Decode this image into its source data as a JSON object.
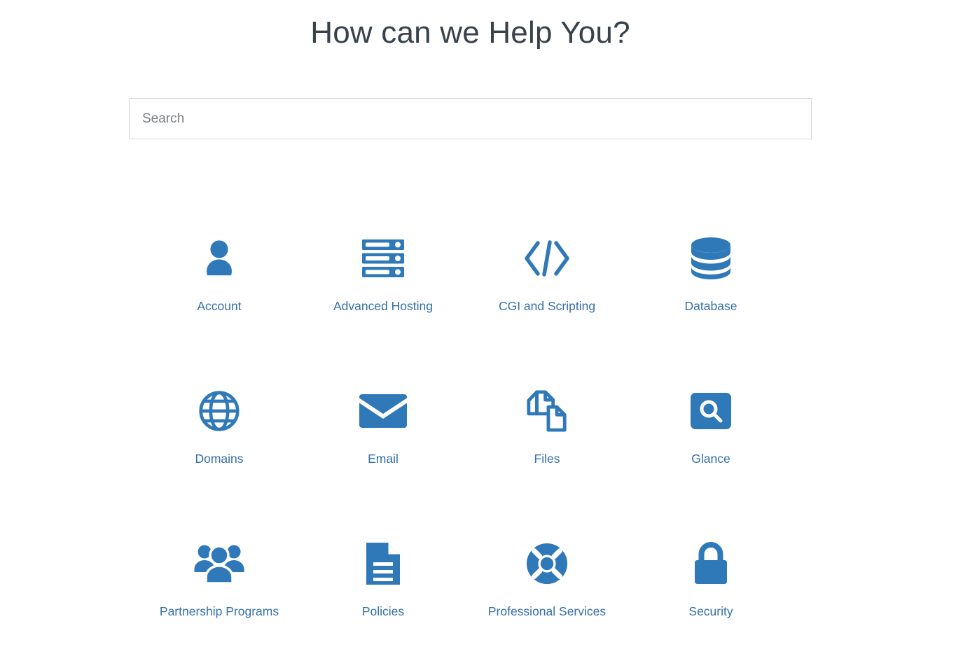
{
  "header": {
    "title": "How can we Help You?"
  },
  "search": {
    "placeholder": "Search",
    "value": ""
  },
  "colors": {
    "icon_blue": "#3079b8",
    "label_blue": "#3570a8",
    "title_slate": "#37424c",
    "input_border": "#d6d6d6",
    "placeholder_gray": "#7a7f85",
    "background": "#ffffff"
  },
  "categories": [
    {
      "label": "Account",
      "icon": "person-icon"
    },
    {
      "label": "Advanced Hosting",
      "icon": "server-rack-icon"
    },
    {
      "label": "CGI and Scripting",
      "icon": "code-brackets-icon"
    },
    {
      "label": "Database",
      "icon": "database-cylinder-icon"
    },
    {
      "label": "Domains",
      "icon": "globe-icon"
    },
    {
      "label": "Email",
      "icon": "envelope-icon"
    },
    {
      "label": "Files",
      "icon": "documents-icon"
    },
    {
      "label": "Glance",
      "icon": "magnifier-square-icon"
    },
    {
      "label": "Partnership Programs",
      "icon": "people-group-icon"
    },
    {
      "label": "Policies",
      "icon": "document-lines-icon"
    },
    {
      "label": "Professional Services",
      "icon": "lifebuoy-icon"
    },
    {
      "label": "Security",
      "icon": "padlock-icon"
    }
  ]
}
